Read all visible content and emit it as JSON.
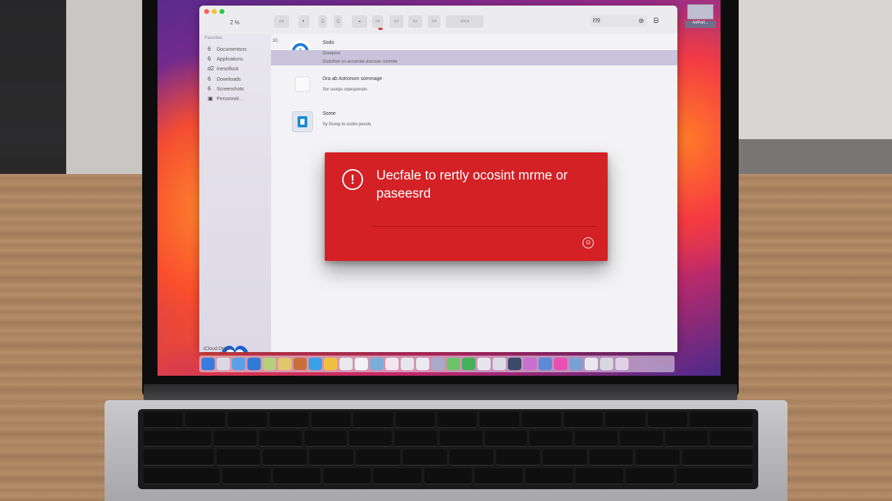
{
  "colors": {
    "dialog_red": "#d32126",
    "selected_row": "#c9c4dc",
    "sidebar_bg": "#e8e6ee"
  },
  "toolbar": {
    "icons": [
      "view-icon",
      "back-icon",
      "forward-icon",
      "share-icon",
      "tag-icon",
      "action-icon",
      "group-icon",
      "gallery-icon"
    ],
    "search_value": "ᗷ9",
    "icon_right_1": "⊕",
    "icon_right_2": "ᗷ"
  },
  "sidebar": {
    "section_header": "Favorites",
    "top_numbers": "2 %",
    "items": [
      {
        "num": "6",
        "label": "Documentsns"
      },
      {
        "num": "6",
        "label": "Applications"
      },
      {
        "num": "d2",
        "label": "Inesoflock"
      },
      {
        "num": "6",
        "label": "Downloads"
      },
      {
        "num": "6",
        "label": "Screenshots"
      },
      {
        "num": "",
        "label": "Personnel..."
      }
    ],
    "footer": "iCloud Drive..."
  },
  "content": {
    "rows": [
      {
        "title": "Sodo",
        "sub": "Dosepost",
        "sub2": "Dsdcthon on accorrate docsson coomtle",
        "badge": "3D"
      },
      {
        "title": "Dra ab Astronom sommage",
        "sub": "Sor scorps orpesporsdo",
        "sub2": ""
      },
      {
        "title": "Soree",
        "sub": "Sy Scoop to scotto poosts",
        "sub2": ""
      }
    ]
  },
  "dialog": {
    "message": "Uecfale to rertly ocosint mrme or paseesrd",
    "icon": "alert-icon",
    "action": "info-icon"
  },
  "side_window": {
    "label": "AirPort..."
  }
}
